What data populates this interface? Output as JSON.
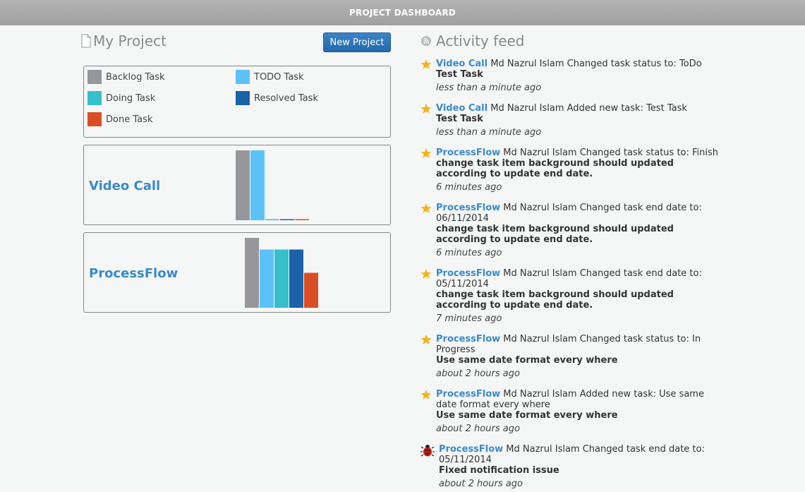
{
  "header": {
    "title": "PROJECT DASHBOARD"
  },
  "my_project": {
    "title": "My Project",
    "new_project_label": "New Project"
  },
  "legend": [
    {
      "label": "Backlog Task",
      "color": "#97969b"
    },
    {
      "label": "TODO Task",
      "color": "#5bc2f7"
    },
    {
      "label": "Doing Task",
      "color": "#36c0cc"
    },
    {
      "label": "Resolved Task",
      "color": "#1c62a8"
    },
    {
      "label": "Done Task",
      "color": "#d94e24"
    }
  ],
  "chart_data": [
    {
      "type": "bar",
      "title": "Video Call",
      "categories": [
        "Backlog Task",
        "TODO Task",
        "Doing Task",
        "Resolved Task",
        "Done Task"
      ],
      "values": [
        1,
        1,
        0,
        0,
        0
      ],
      "colors": [
        "#97969b",
        "#5bc2f7",
        "#36c0cc",
        "#1c62a8",
        "#d94e24"
      ],
      "ylim": [
        0,
        1
      ]
    },
    {
      "type": "bar",
      "title": "ProcessFlow",
      "categories": [
        "Backlog Task",
        "TODO Task",
        "Doing Task",
        "Resolved Task",
        "Done Task"
      ],
      "values": [
        6,
        5,
        5,
        5,
        3
      ],
      "colors": [
        "#97969b",
        "#5bc2f7",
        "#36c0cc",
        "#1c62a8",
        "#d94e24"
      ],
      "ylim": [
        0,
        6
      ]
    }
  ],
  "activity": {
    "title": "Activity feed",
    "items": [
      {
        "icon": "star-icon",
        "project": "Video Call",
        "text": " Md Nazrul Islam Changed task status to: ToDo",
        "task": "Test Task",
        "time": "less than a minute ago"
      },
      {
        "icon": "star-icon",
        "project": "Video Call",
        "text": " Md Nazrul Islam Added new task: Test Task",
        "task": "Test Task",
        "time": "less than a minute ago"
      },
      {
        "icon": "star-icon",
        "project": "ProcessFlow",
        "text": " Md Nazrul Islam Changed task status to: Finish",
        "task": "change task item background should updated according to update end date.",
        "time": "6 minutes ago"
      },
      {
        "icon": "star-icon",
        "project": "ProcessFlow",
        "text": " Md Nazrul Islam Changed task end date to: 06/11/2014",
        "task": "change task item background should updated according to update end date.",
        "time": "6 minutes ago"
      },
      {
        "icon": "star-icon",
        "project": "ProcessFlow",
        "text": " Md Nazrul Islam Changed task end date to: 05/11/2014",
        "task": "change task item background should updated according to update end date.",
        "time": "7 minutes ago"
      },
      {
        "icon": "star-icon",
        "project": "ProcessFlow",
        "text": " Md Nazrul Islam Changed task status to: In Progress",
        "task": "Use same date format every where",
        "time": "about 2 hours ago"
      },
      {
        "icon": "star-icon",
        "project": "ProcessFlow",
        "text": " Md Nazrul Islam Added new task: Use same date format every where",
        "task": "Use same date format every where",
        "time": "about 2 hours ago"
      },
      {
        "icon": "bug-icon",
        "project": "ProcessFlow",
        "text": " Md Nazrul Islam Changed task end date to: 05/11/2014",
        "task": "Fixed notification issue",
        "time": "about 2 hours ago"
      }
    ]
  }
}
